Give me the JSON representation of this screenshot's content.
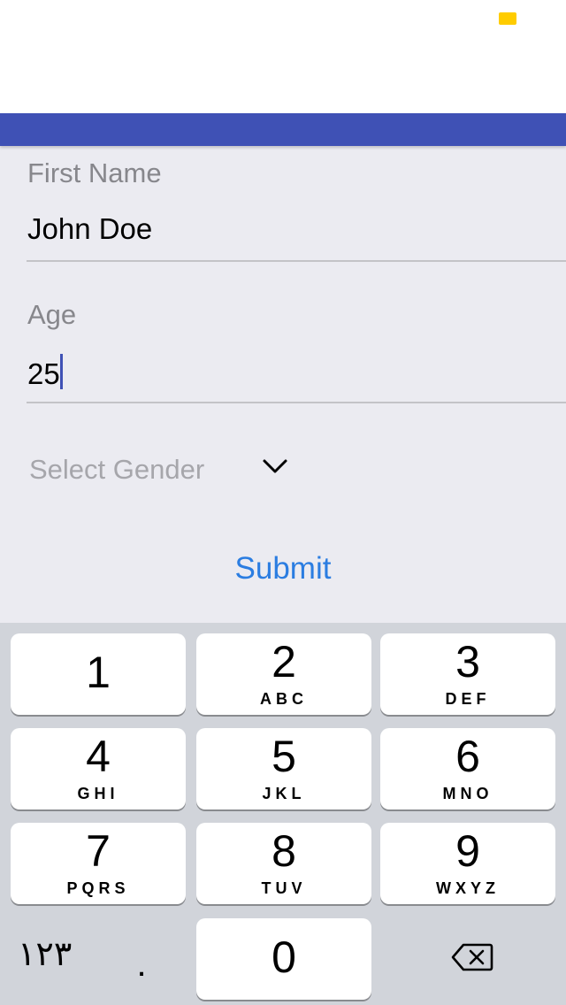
{
  "colors": {
    "app_bar": "#3f51b5",
    "battery": "#ffcc00",
    "accent_link": "#2b7de1",
    "caret": "#3f51b5"
  },
  "status_bar": {
    "battery_icon": "battery-icon"
  },
  "form": {
    "first_name": {
      "label": "First Name",
      "value": "John Doe"
    },
    "age": {
      "label": "Age",
      "value": "25"
    },
    "gender": {
      "placeholder": "Select Gender",
      "icon": "chevron-down-icon"
    },
    "submit_label": "Submit"
  },
  "keypad": {
    "keys": [
      {
        "digit": "1",
        "letters": ""
      },
      {
        "digit": "2",
        "letters": "ABC"
      },
      {
        "digit": "3",
        "letters": "DEF"
      },
      {
        "digit": "4",
        "letters": "GHI"
      },
      {
        "digit": "5",
        "letters": "JKL"
      },
      {
        "digit": "6",
        "letters": "MNO"
      },
      {
        "digit": "7",
        "letters": "PQRS"
      },
      {
        "digit": "8",
        "letters": "TUV"
      },
      {
        "digit": "9",
        "letters": "WXYZ"
      },
      {
        "digit": "0",
        "letters": ""
      }
    ],
    "alt_digits_label": "١٢٣",
    "decimal_label": ".",
    "delete_icon": "backspace-icon"
  }
}
